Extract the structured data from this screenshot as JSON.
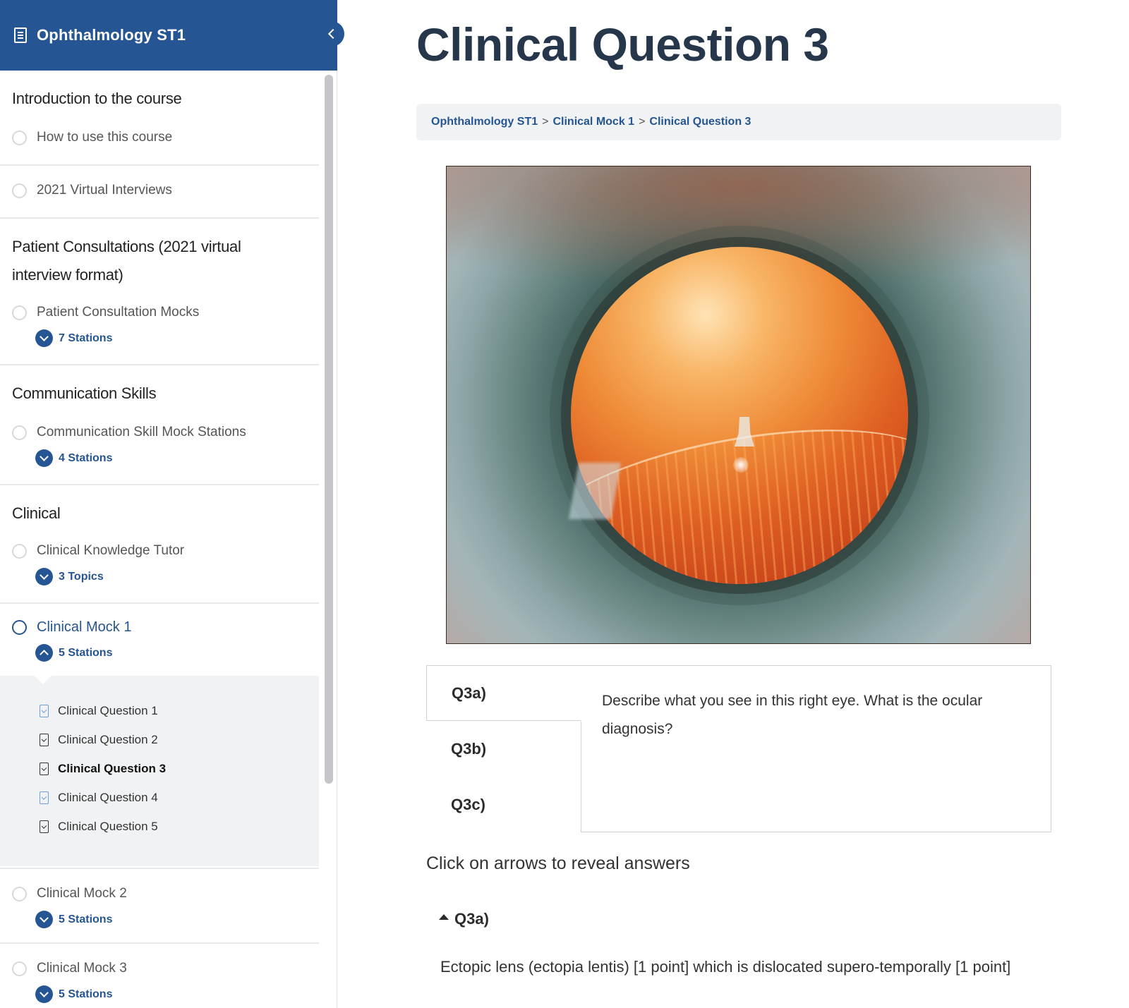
{
  "course": {
    "title": "Ophthalmology ST1"
  },
  "sidebar": {
    "sections": [
      {
        "title": "Introduction to the course",
        "lessons": [
          {
            "label": "How to use this course"
          }
        ]
      },
      {
        "title": "",
        "lessons": [
          {
            "label": "2021 Virtual Interviews"
          }
        ]
      },
      {
        "title": "Patient Consultations (2021 virtual interview format)",
        "lessons": [
          {
            "label": "Patient Consultation Mocks",
            "expander": "7 Stations"
          }
        ]
      },
      {
        "title": "Communication Skills",
        "lessons": [
          {
            "label": "Communication Skill Mock Stations",
            "expander": "4 Stations"
          }
        ]
      },
      {
        "title": "Clinical",
        "lessons": [
          {
            "label": "Clinical Knowledge Tutor",
            "expander": "3 Topics"
          },
          {
            "label": "Clinical Mock 1",
            "expander": "5 Stations",
            "active": true,
            "topics": [
              "Clinical Question 1",
              "Clinical Question 2",
              "Clinical Question 3",
              "Clinical Question 4",
              "Clinical Question 5"
            ]
          },
          {
            "label": "Clinical Mock 2",
            "expander": "5 Stations"
          },
          {
            "label": "Clinical Mock 3",
            "expander": "5 Stations"
          }
        ]
      }
    ]
  },
  "main": {
    "title": "Clinical Question 3",
    "breadcrumb": [
      "Ophthalmology ST1",
      "Clinical Mock 1",
      "Clinical Question 3"
    ],
    "breadcrumb_sep": ">",
    "tabs": [
      "Q3a)",
      "Q3b)",
      "Q3c)"
    ],
    "active_tab_text": "Describe what you see in this right eye. What is the ocular diagnosis?",
    "instruction": "Click on arrows to reveal answers",
    "accordion": {
      "label": "Q3a)",
      "answer": "Ectopic lens (ectopia lentis) [1 point] which is dislocated supero-temporally [1 point]"
    }
  },
  "colors": {
    "brand": "#255592",
    "title": "#27374b",
    "panel": "#f1f2f4"
  }
}
